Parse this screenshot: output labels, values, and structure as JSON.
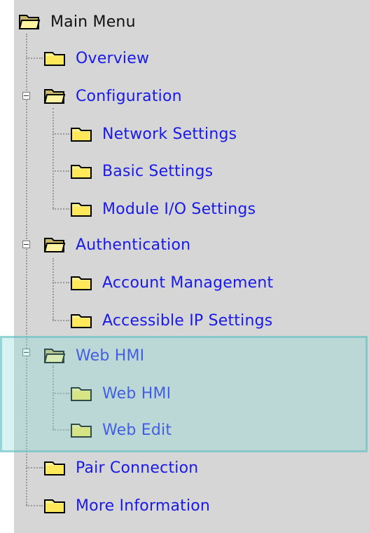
{
  "menu": {
    "root": "Main Menu",
    "overview": "Overview",
    "configuration": {
      "label": "Configuration",
      "children": [
        "Network Settings",
        "Basic Settings",
        "Module I/O Settings"
      ]
    },
    "authentication": {
      "label": "Authentication",
      "children": [
        "Account Management",
        "Accessible IP Settings"
      ]
    },
    "web_hmi": {
      "label": "Web HMI",
      "children": [
        "Web HMI",
        "Web Edit"
      ]
    },
    "pair_connection": "Pair Connection",
    "more_information": "More Information"
  },
  "icons": {
    "open_folder": "folder-open-icon",
    "closed_folder": "folder-closed-icon",
    "collapse": "minus-box-icon"
  },
  "colors": {
    "panel_bg": "#d6d6d6",
    "link": "#1a1ae6",
    "highlight": "#8cdcd7"
  }
}
